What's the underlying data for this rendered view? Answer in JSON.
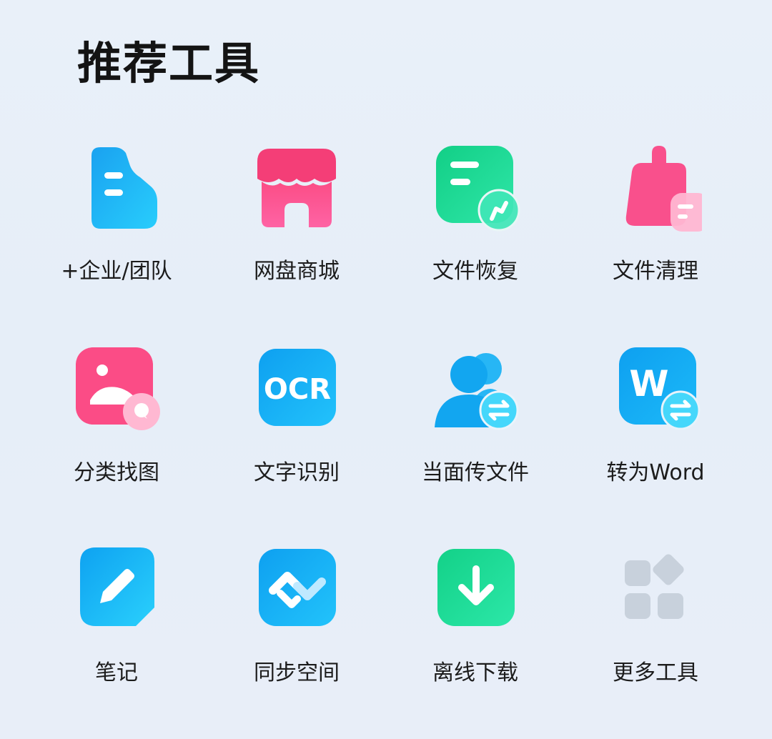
{
  "header": {
    "title": "推荐工具"
  },
  "tools": [
    {
      "label": "+企业/团队",
      "icon": "enterprise-team-icon"
    },
    {
      "label": "网盘商城",
      "icon": "store-icon"
    },
    {
      "label": "文件恢复",
      "icon": "file-recovery-icon"
    },
    {
      "label": "文件清理",
      "icon": "file-cleanup-icon"
    },
    {
      "label": "分类找图",
      "icon": "photo-category-icon"
    },
    {
      "label": "文字识别",
      "icon": "ocr-icon",
      "icon_text": "OCR"
    },
    {
      "label": "当面传文件",
      "icon": "face-to-face-transfer-icon"
    },
    {
      "label": "转为Word",
      "icon": "convert-to-word-icon",
      "icon_text": "W"
    },
    {
      "label": "笔记",
      "icon": "notes-icon"
    },
    {
      "label": "同步空间",
      "icon": "sync-space-icon"
    },
    {
      "label": "离线下载",
      "icon": "offline-download-icon"
    },
    {
      "label": "更多工具",
      "icon": "more-tools-icon"
    }
  ],
  "colors": {
    "blue": "#10a6f2",
    "blue_light": "#27c6fb",
    "pink": "#fb4f8c",
    "green": "#16d48c",
    "green_light": "#2ee7a6",
    "grey": "#c8d1dc"
  }
}
